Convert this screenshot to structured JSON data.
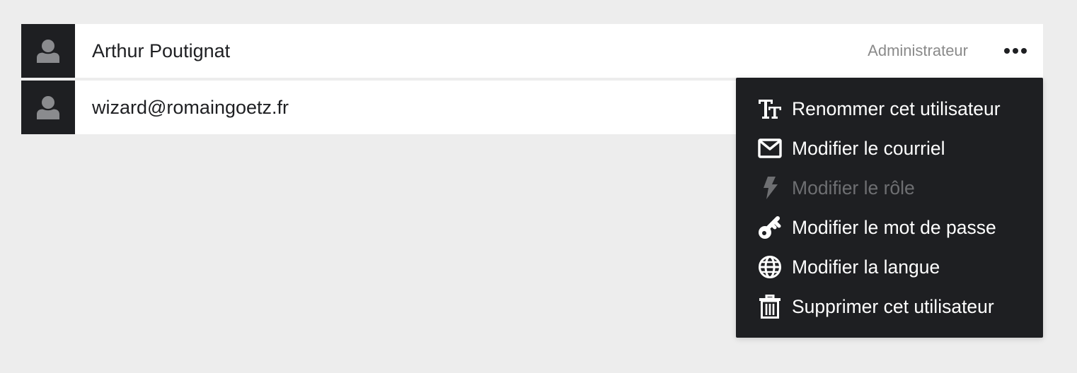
{
  "users": [
    {
      "name": "Arthur Poutignat",
      "role": "Administrateur"
    },
    {
      "name": "wizard@romaingoetz.fr",
      "role": ""
    }
  ],
  "menu": {
    "items": [
      {
        "label": "Renommer cet utilisateur",
        "icon": "text-size-icon",
        "disabled": false
      },
      {
        "label": "Modifier le courriel",
        "icon": "envelope-icon",
        "disabled": false
      },
      {
        "label": "Modifier le rôle",
        "icon": "lightning-icon",
        "disabled": true
      },
      {
        "label": "Modifier le mot de passe",
        "icon": "key-icon",
        "disabled": false
      },
      {
        "label": "Modifier la langue",
        "icon": "globe-icon",
        "disabled": false
      },
      {
        "label": "Supprimer cet utilisateur",
        "icon": "trash-icon",
        "disabled": false
      }
    ]
  },
  "colors": {
    "background": "#ededed",
    "dark": "#1e1f22",
    "role_text": "#8a8a8a",
    "menu_text": "#ffffff",
    "menu_disabled": "#6e6f72"
  }
}
